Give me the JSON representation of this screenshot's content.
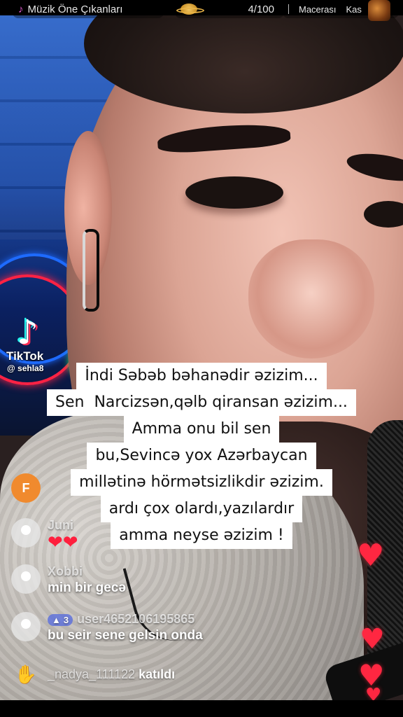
{
  "live_header": {
    "music_pill": {
      "icon": "music-note-icon",
      "label": "Müzik Öne Çıkanları"
    },
    "rank_pill": {
      "icon": "planet-icon",
      "value": "4/100"
    },
    "adventure_pill": {
      "label": "Macerası",
      "extra": "Kas"
    }
  },
  "overlay_brand": {
    "name": "TikTok",
    "handle": "@ sehla8"
  },
  "caption": {
    "lines": [
      "İndi Səbəb bəhanədir əzizim...",
      "Sen  Narcizsən,qəlb qiransan əzizim...",
      "Amma onu bil sen",
      "bu,Sevincə yox Azərbaycan",
      "millətinə hörmətsizlikdir əzizim.",
      "ardı çox olardı,yazılardır",
      "amma neyse əzizim !"
    ]
  },
  "comments": [
    {
      "avatar": "F",
      "avatar_color": "#f08a2e",
      "user": "",
      "text": ""
    },
    {
      "avatar": "default",
      "user": "Juni",
      "text": "❤❤"
    },
    {
      "avatar": "default",
      "user": "Xobbi",
      "text": "min bir gecə"
    },
    {
      "avatar": "default",
      "badge": "3",
      "user": "user4652106195865",
      "text": "bu seir sene gelsin onda"
    }
  ],
  "join_notice": {
    "icon": "wave-hand-icon",
    "user": "_nadya_111122",
    "action": "katıldı"
  },
  "colors": {
    "caption_bg": "#ffffff",
    "heart": "#ff2741",
    "tiktok_red": "#fe2c55",
    "tiktok_cyan": "#25f4ee"
  }
}
